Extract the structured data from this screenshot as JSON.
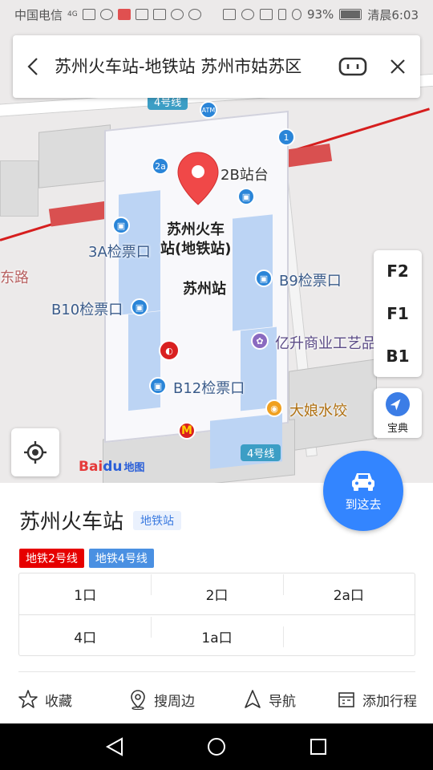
{
  "status_bar": {
    "carrier": "中国电信",
    "network": "4G",
    "battery": "93%",
    "time": "清晨6:03"
  },
  "search": {
    "query": "苏州火车站-地铁站 苏州市姑苏区"
  },
  "map": {
    "station_label_line1": "苏州火车",
    "station_label_line2": "站(地铁站)",
    "station_name": "苏州站",
    "labels": {
      "b2": "2B站台",
      "a3": "3A检票口",
      "b9": "B9检票口",
      "b10": "B10检票口",
      "b12": "B12检票口",
      "yisheng": "亿升商业工艺品",
      "daniang": "大娘水饺",
      "road": "东路",
      "line4_top": "4号线",
      "line4_bottom": "4号线",
      "poi_2a": "2a",
      "poi_1": "1",
      "atm": "ATM"
    },
    "floors": [
      "F2",
      "F1",
      "B1"
    ],
    "baodian_label": "宝典",
    "logo_bai": "Bai",
    "logo_du": "du",
    "logo_map": "地图"
  },
  "go_button": {
    "label": "到这去"
  },
  "poi": {
    "title": "苏州火车站",
    "type_tag": "地铁站",
    "lines": [
      {
        "label": "地铁2号线",
        "color": "#e60000"
      },
      {
        "label": "地铁4号线",
        "color": "#4a90e2"
      }
    ],
    "exits_row1": [
      "1口",
      "2口",
      "2a口"
    ],
    "exits_row2": [
      "4口",
      "1a口"
    ]
  },
  "actions": {
    "favorite": "收藏",
    "nearby": "搜周边",
    "navigate": "导航",
    "add_trip": "添加行程"
  },
  "colors": {
    "accent": "#3385ff",
    "line2": "#e60000",
    "line4": "#4a90e2"
  }
}
